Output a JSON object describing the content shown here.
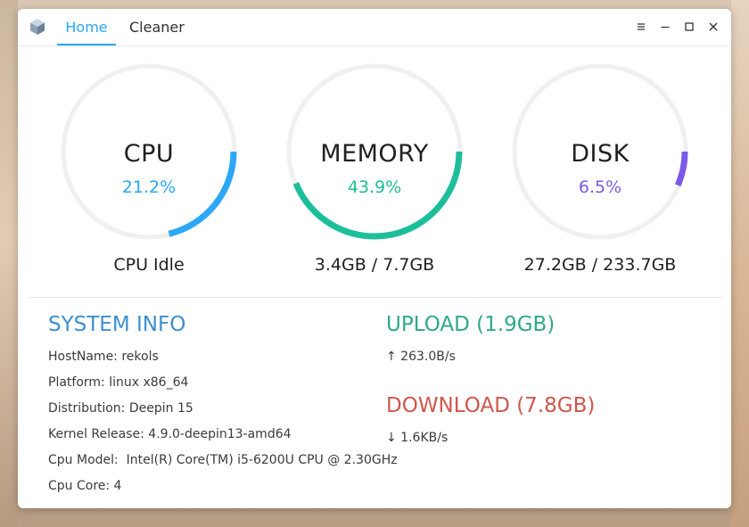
{
  "colors": {
    "accent": "#2ca7f8",
    "cpu": "#2ca7f8",
    "memory": "#1dbf9a",
    "disk": "#7a5ae8",
    "track": "#f0f0f0",
    "system_info": "#3d8fd0",
    "upload": "#2fa88a",
    "download": "#d0564c"
  },
  "titlebar": {
    "app_icon": "cube-icon",
    "tabs": [
      {
        "label": "Home",
        "active": true
      },
      {
        "label": "Cleaner",
        "active": false
      }
    ],
    "controls": [
      "menu-icon",
      "minimize-icon",
      "maximize-icon",
      "close-icon"
    ]
  },
  "gauges": [
    {
      "key": "cpu",
      "title": "CPU",
      "percent_label": "21.2%",
      "percent": 21.2,
      "subtitle": "CPU Idle"
    },
    {
      "key": "memory",
      "title": "MEMORY",
      "percent_label": "43.9%",
      "percent": 43.9,
      "subtitle": "3.4GB / 7.7GB"
    },
    {
      "key": "disk",
      "title": "DISK",
      "percent_label": "6.5%",
      "percent": 6.5,
      "subtitle": "27.2GB / 233.7GB"
    }
  ],
  "system_info": {
    "title": "SYSTEM INFO",
    "lines": [
      "HostName: rekols",
      "Platform: linux x86_64",
      "Distribution: Deepin 15",
      "Kernel Release: 4.9.0-deepin13-amd64",
      "Cpu Model:  Intel(R) Core(TM) i5-6200U CPU @ 2.30GHz",
      "Cpu Core: 4"
    ]
  },
  "network": {
    "upload": {
      "title": "UPLOAD (1.9GB)",
      "speed": "↑ 263.0B/s"
    },
    "download": {
      "title": "DOWNLOAD (7.8GB)",
      "speed": "↓ 1.6KB/s"
    }
  }
}
